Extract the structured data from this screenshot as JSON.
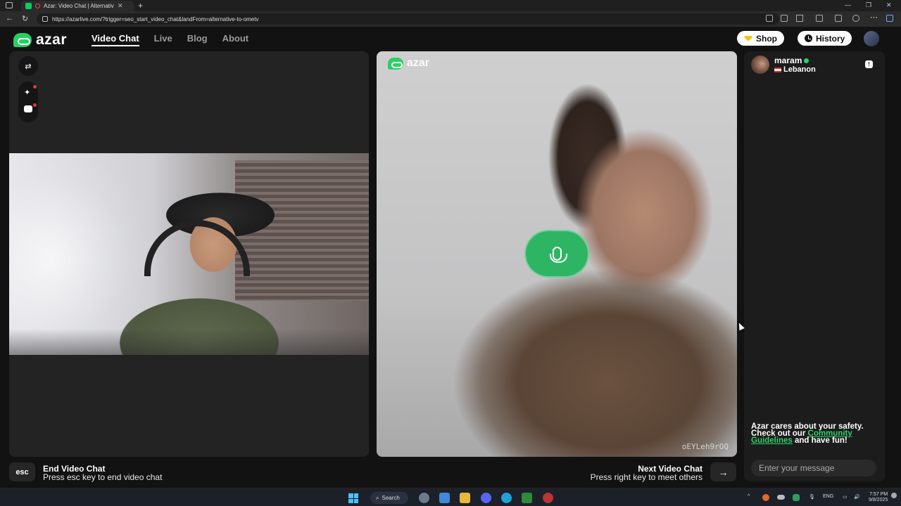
{
  "browser": {
    "tab_title": "Azar: Video Chat | Alternative",
    "url": "https://azarlive.com/?trigger=seo_start_video_chat&landFrom=alternative-to-ometv"
  },
  "header": {
    "logo_text": "azar",
    "nav": [
      "Video Chat",
      "Live",
      "Blog",
      "About"
    ],
    "active_nav": "Video Chat",
    "shop_label": "Shop",
    "history_label": "History"
  },
  "remote": {
    "watermark": "azar",
    "id_code": "oEYLeh9rOQ"
  },
  "chat": {
    "peer_name": "maram",
    "peer_country": "Lebanon",
    "safety_text_1": "Azar cares about your safety. Check out our",
    "safety_link": "Community Guidelines",
    "safety_text_2": "and have fun!",
    "input_placeholder": "Enter your message"
  },
  "controls": {
    "esc_key": "esc",
    "end_title": "End Video Chat",
    "end_sub": "Press esc key to end video chat",
    "next_title": "Next Video Chat",
    "next_sub": "Press right key to meet others",
    "next_key_icon": "→"
  },
  "taskbar": {
    "search_label": "Search",
    "lang": "ENG",
    "time": "7:57 PM",
    "date": "9/8/2025"
  },
  "colors": {
    "brand_green": "#23d160",
    "mic_green": "#2eb564",
    "online_dot": "#2fd06a",
    "alert_dot": "#e8344a"
  }
}
